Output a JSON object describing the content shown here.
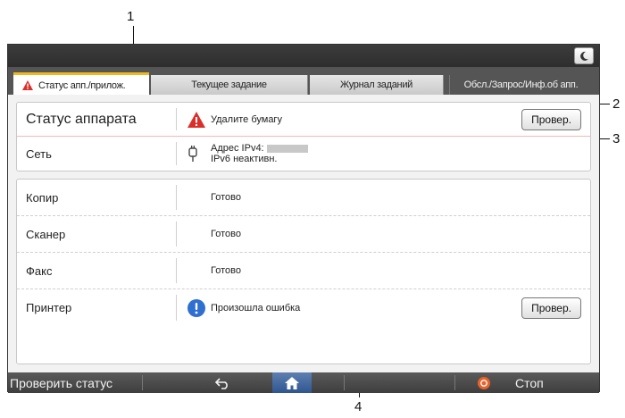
{
  "callouts": [
    "1",
    "2",
    "3",
    "4"
  ],
  "tabs": [
    {
      "label": "Статус апп./прилож.",
      "icon": "warning-icon",
      "active": true
    },
    {
      "label": "Текущее задание",
      "active": false
    },
    {
      "label": "Журнал заданий",
      "active": false
    },
    {
      "label": "Обсл./Запрос/Инф.об апп.",
      "active": false
    }
  ],
  "machine_status": {
    "label": "Статус аппарата",
    "icon": "warning-triangle-icon",
    "value": "Удалите бумагу",
    "button": "Провер."
  },
  "network": {
    "label": "Сеть",
    "icon": "network-plug-icon",
    "ipv4_label": "Адрес IPv4:",
    "ipv6_label": "IPv6 неактивн."
  },
  "functions": [
    {
      "label": "Копир",
      "value": "Готово"
    },
    {
      "label": "Сканер",
      "value": "Готово"
    },
    {
      "label": "Факс",
      "value": "Готово"
    }
  ],
  "printer": {
    "label": "Принтер",
    "icon": "info-exclamation-icon",
    "value": "Произошла ошибка",
    "button": "Провер."
  },
  "bottom_bar": {
    "check_status": "Проверить статус",
    "stop": "Стоп"
  },
  "colors": {
    "warning_red": "#d9302c",
    "info_blue": "#2f6fd0",
    "active_tab_accent": "#f0b820",
    "home_blue": "#2f568f",
    "stop_orange": "#e8622a"
  }
}
